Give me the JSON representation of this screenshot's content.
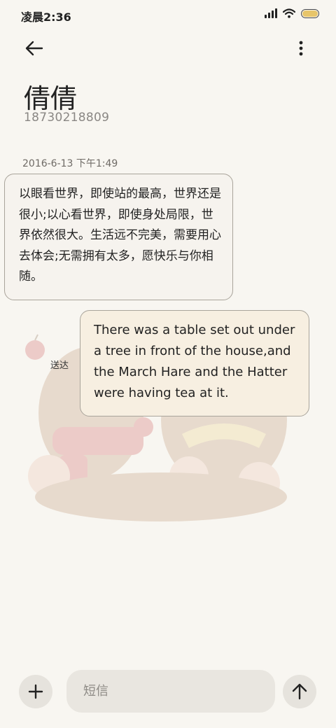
{
  "status_bar": {
    "time": "凌晨2:36",
    "battery_color": "#e7c56a"
  },
  "header": {
    "back_icon": "arrow-left-icon",
    "more_icon": "more-vertical-icon"
  },
  "contact": {
    "name": "倩倩",
    "phone": "18730218809"
  },
  "conversation": {
    "date": "2016-6-13 下午1:49",
    "incoming": {
      "text": "以眼看世界，即使站的最高，世界还是很小;以心看世界，即使身处局限，世界依然很大。生活远不完美，需要用心去体会;无需拥有太多，愿快乐与你相随。"
    },
    "outgoing": {
      "text": "There was a table set out under a tree in front of the house,and the March Hare and the Hatter were having tea at it.",
      "status": "送达"
    }
  },
  "composer": {
    "placeholder": "短信",
    "add_icon": "plus-icon",
    "send_icon": "arrow-up-icon"
  }
}
